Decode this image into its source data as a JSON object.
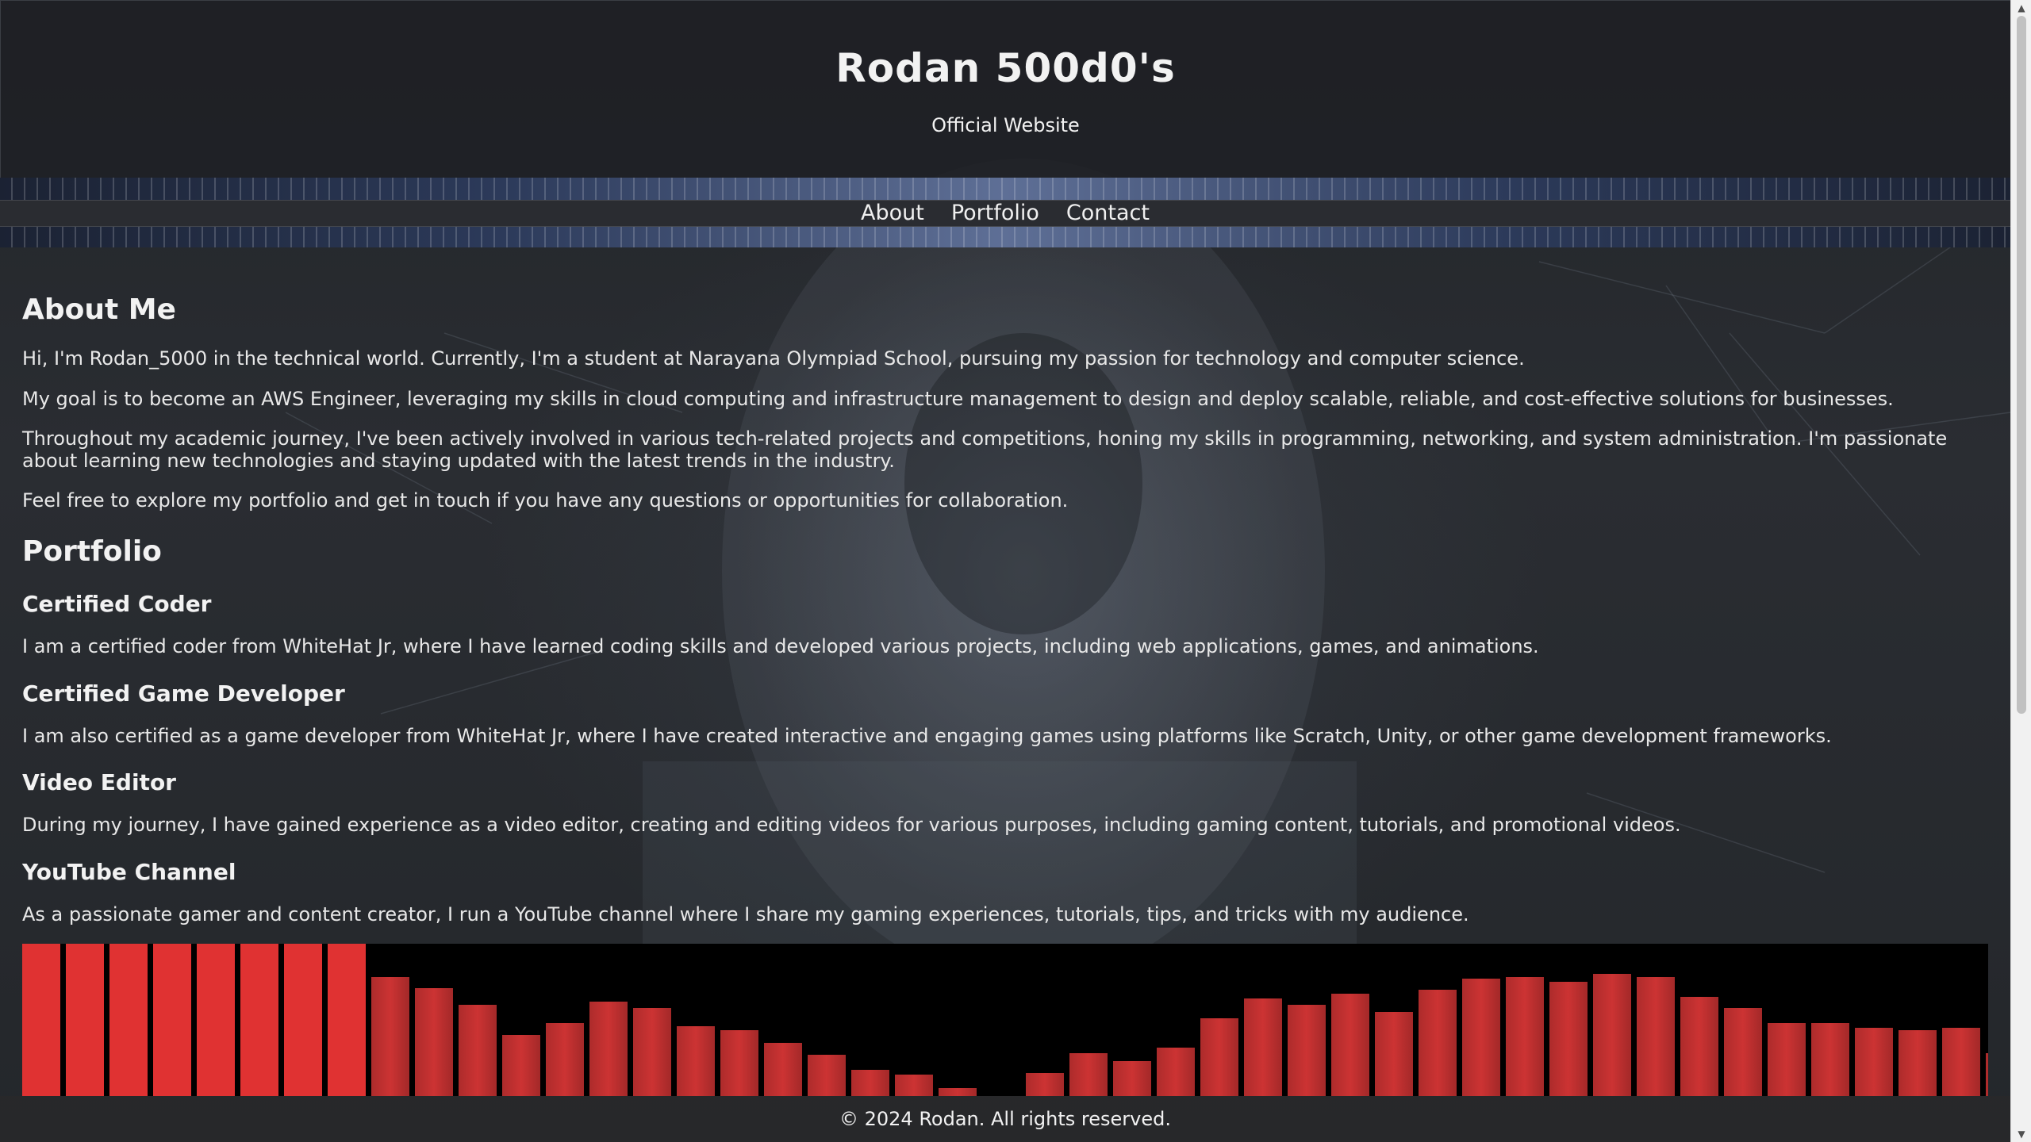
{
  "header": {
    "title": "Rodan 500d0's",
    "subtitle": "Official Website"
  },
  "nav": {
    "items": [
      {
        "label": "About"
      },
      {
        "label": "Portfolio"
      },
      {
        "label": "Contact"
      }
    ]
  },
  "about": {
    "heading": "About Me",
    "paragraphs": [
      "Hi, I'm Rodan_5000 in the technical world. Currently, I'm a student at Narayana Olympiad School, pursuing my passion for technology and computer science.",
      "My goal is to become an AWS Engineer, leveraging my skills in cloud computing and infrastructure management to design and deploy scalable, reliable, and cost-effective solutions for businesses.",
      "Throughout my academic journey, I've been actively involved in various tech-related projects and competitions, honing my skills in programming, networking, and system administration. I'm passionate about learning new technologies and staying updated with the latest trends in the industry.",
      "Feel free to explore my portfolio and get in touch if you have any questions or opportunities for collaboration."
    ]
  },
  "portfolio": {
    "heading": "Portfolio",
    "items": [
      {
        "title": "Certified Coder",
        "text": "I am a certified coder from WhiteHat Jr, where I have learned coding skills and developed various projects, including web applications, games, and animations."
      },
      {
        "title": "Certified Game Developer",
        "text": "I am also certified as a game developer from WhiteHat Jr, where I have created interactive and engaging games using platforms like Scratch, Unity, or other game development frameworks."
      },
      {
        "title": "Video Editor",
        "text": "During my journey, I have gained experience as a video editor, creating and editing videos for various purposes, including gaming content, tutorials, and promotional videos."
      },
      {
        "title": "YouTube Channel",
        "text": "As a passionate gamer and content creator, I run a YouTube channel where I share my gaming experiences, tutorials, tips, and tricks with my audience."
      }
    ]
  },
  "visualizer": {
    "bar_color": "#cc3333",
    "levels": [
      1.0,
      1.0,
      1.0,
      1.0,
      1.0,
      1.0,
      1.0,
      1.0,
      0.78,
      0.71,
      0.6,
      0.4,
      0.48,
      0.62,
      0.58,
      0.46,
      0.43,
      0.35,
      0.27,
      0.17,
      0.14,
      0.05,
      0.0,
      0.15,
      0.28,
      0.23,
      0.32,
      0.51,
      0.64,
      0.6,
      0.67,
      0.55,
      0.7,
      0.77,
      0.78,
      0.75,
      0.8,
      0.78,
      0.65,
      0.58,
      0.48,
      0.48,
      0.45,
      0.43,
      0.45,
      0.28
    ]
  },
  "footer": {
    "text": "© 2024 Rodan. All rights reserved."
  },
  "colors": {
    "background": "#1e2024",
    "text": "#e6e6e6",
    "accent_bar": "#cc3333"
  }
}
